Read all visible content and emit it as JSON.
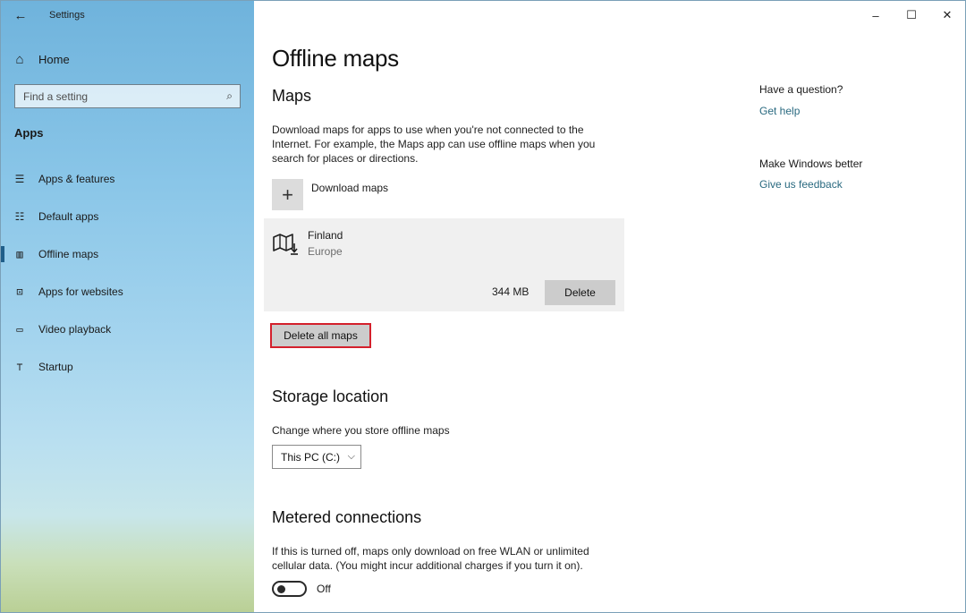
{
  "window": {
    "title": "Settings",
    "controls": {
      "minimize": "–",
      "maximize": "☐",
      "close": "✕"
    }
  },
  "sidebar": {
    "back_icon": "back-arrow-icon",
    "home": {
      "label": "Home",
      "icon": "home-icon"
    },
    "search": {
      "placeholder": "Find a setting",
      "icon": "search-icon"
    },
    "section": "Apps",
    "items": [
      {
        "label": "Apps & features",
        "icon": "apps-features-icon",
        "selected": false
      },
      {
        "label": "Default apps",
        "icon": "default-apps-icon",
        "selected": false
      },
      {
        "label": "Offline maps",
        "icon": "offline-maps-icon",
        "selected": true
      },
      {
        "label": "Apps for websites",
        "icon": "apps-for-websites-icon",
        "selected": false
      },
      {
        "label": "Video playback",
        "icon": "video-playback-icon",
        "selected": false
      },
      {
        "label": "Startup",
        "icon": "startup-icon",
        "selected": false
      }
    ]
  },
  "main": {
    "title": "Offline maps",
    "maps": {
      "heading": "Maps",
      "description": "Download maps for apps to use when you're not connected to the Internet. For example, the Maps app can use offline maps when you search for places or directions.",
      "download_label": "Download maps",
      "items": [
        {
          "name": "Finland",
          "region": "Europe",
          "size": "344 MB",
          "delete_label": "Delete"
        }
      ],
      "delete_all_label": "Delete all maps"
    },
    "storage": {
      "heading": "Storage location",
      "description": "Change where you store offline maps",
      "selected": "This PC (C:)"
    },
    "metered": {
      "heading": "Metered connections",
      "description": "If this is turned off, maps only download on free WLAN or unlimited cellular data. (You might incur additional charges if you turn it on).",
      "toggle_state": "Off"
    }
  },
  "aside": {
    "question": "Have a question?",
    "help_link": "Get help",
    "feedback_heading": "Make Windows better",
    "feedback_link": "Give us feedback"
  },
  "colors": {
    "accent_link": "#2a6a80",
    "highlight_border": "#d4202c",
    "selected_indicator": "#1f5e8a"
  }
}
